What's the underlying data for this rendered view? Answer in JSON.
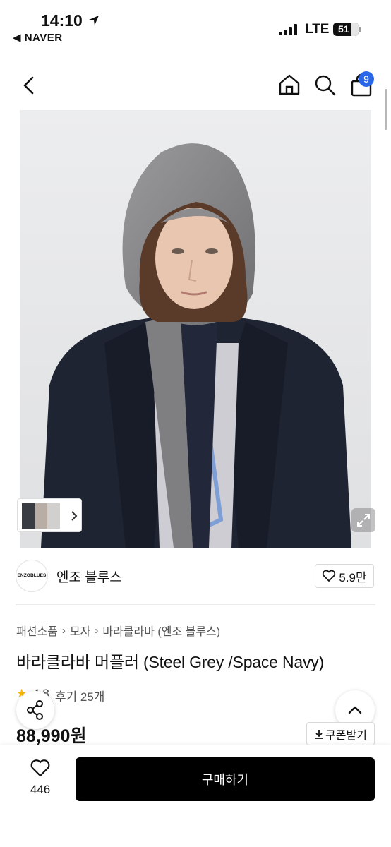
{
  "status_bar": {
    "time": "14:10",
    "back_app": "◀ NAVER",
    "network": "LTE",
    "battery": "51"
  },
  "header": {
    "cart_count": "9",
    "icons": [
      "back-chevron-icon",
      "home-icon",
      "search-icon",
      "shopping-bag-icon"
    ]
  },
  "gallery": {
    "thumbs_icon": "chevron-right-icon",
    "expand_icon": "expand-icon"
  },
  "brand": {
    "logo_text": "ENZOBLUES",
    "name": "엔조 블루스",
    "likes": "5.9만"
  },
  "breadcrumb": [
    "패션소품",
    "모자",
    "바라클라바 (엔조 블루스)"
  ],
  "product": {
    "title": "바라클라바 머플러 (Steel Grey /Space Navy)",
    "rating": "4.8",
    "review_link": "후기 25개",
    "price": "88,990원",
    "coupon_label": "쿠폰받기"
  },
  "bottom_bar": {
    "wish_count": "446",
    "buy_label": "구매하기"
  },
  "colors": {
    "accent_badge": "#2a67e8",
    "buy_button": "#000000",
    "coat": "#1f2433",
    "hood": "#8a8a8c"
  }
}
